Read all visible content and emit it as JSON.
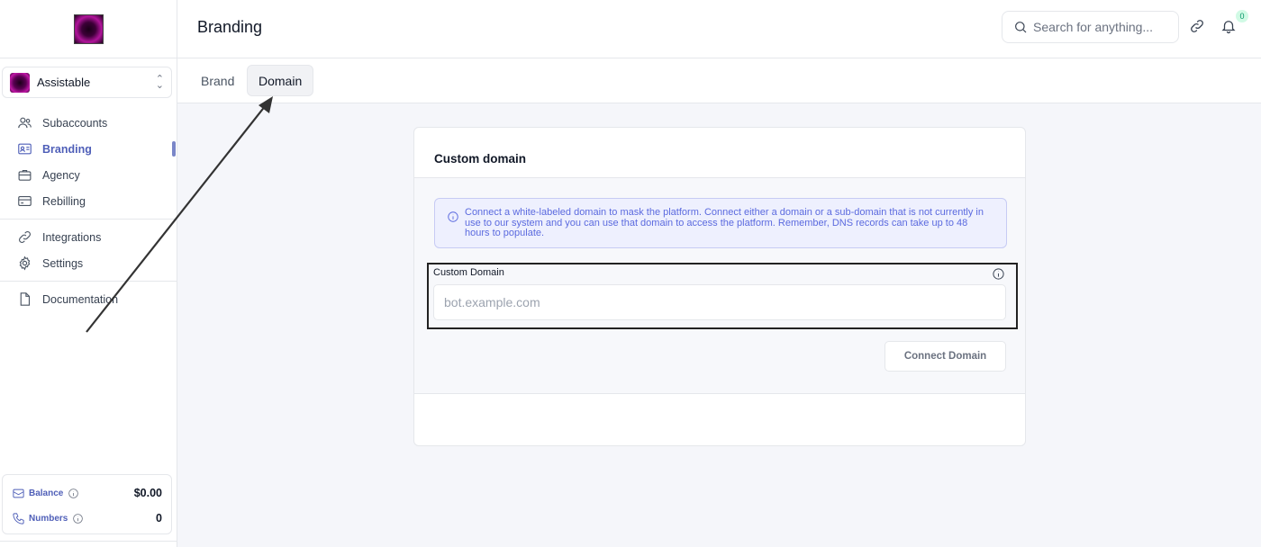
{
  "app": {
    "account_name": "Assistable"
  },
  "header": {
    "title": "Branding",
    "search_placeholder": "Search for anything...",
    "notification_count": "0"
  },
  "sidebar": {
    "items": [
      {
        "label": "Subaccounts",
        "icon": "users-icon"
      },
      {
        "label": "Branding",
        "icon": "id-card-icon",
        "active": true
      },
      {
        "label": "Agency",
        "icon": "briefcase-icon"
      },
      {
        "label": "Rebilling",
        "icon": "credit-card-icon"
      },
      {
        "label": "Integrations",
        "icon": "link-icon"
      },
      {
        "label": "Settings",
        "icon": "gear-icon"
      },
      {
        "label": "Documentation",
        "icon": "document-icon"
      }
    ],
    "balance": {
      "label": "Balance",
      "value": "$0.00"
    },
    "numbers": {
      "label": "Numbers",
      "value": "0"
    }
  },
  "tabs": [
    {
      "label": "Brand",
      "active": false
    },
    {
      "label": "Domain",
      "active": true
    }
  ],
  "card": {
    "title": "Custom domain",
    "alert_text": "Connect a white-labeled domain to mask the platform. Connect either a domain or a sub-domain that is not currently in use to our system and you can use that domain to access the platform. Remember, DNS records can take up to 48 hours to populate.",
    "field_label": "Custom Domain",
    "field_placeholder": "bot.example.com",
    "field_value": "",
    "button_label": "Connect Domain"
  },
  "colors": {
    "accent": "#4f5fb8",
    "alert_text": "#5b6adf",
    "alert_bg": "#eef0fe"
  }
}
